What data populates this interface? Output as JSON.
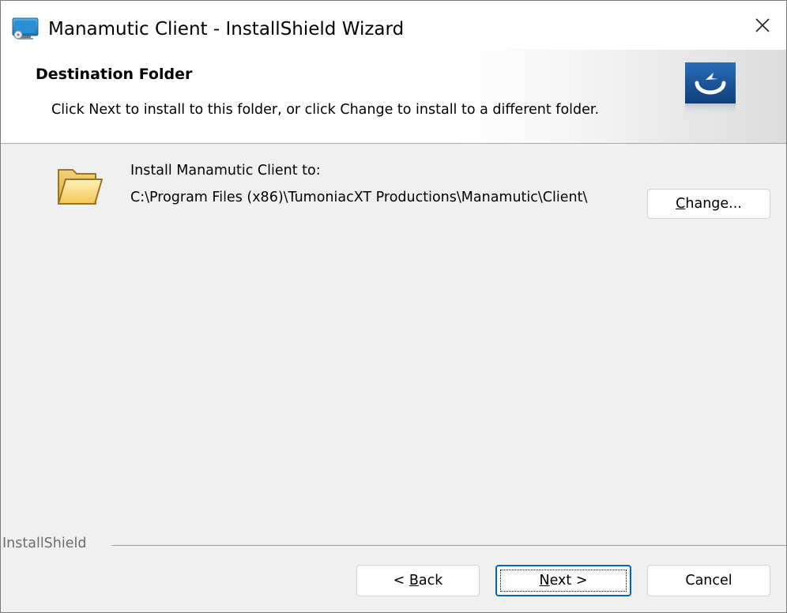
{
  "window": {
    "title": "Manamutic Client - InstallShield Wizard",
    "close_icon": "close-icon",
    "app_icon": "installer-app-icon"
  },
  "banner": {
    "title": "Destination Folder",
    "subtitle": "Click Next to install to this folder, or click Change to install to a different folder.",
    "logo_icon": "installshield-logo-icon"
  },
  "destination": {
    "label": "Install Manamutic Client to:",
    "path": "C:\\Program Files (x86)\\TumoniacXT Productions\\Manamutic\\Client\\",
    "folder_icon": "folder-icon",
    "change_button": {
      "mnemonic": "C",
      "rest": "hange..."
    }
  },
  "footer": {
    "brand_label": "InstallShield",
    "back_button": {
      "prefix": "< ",
      "mnemonic": "B",
      "rest": "ack"
    },
    "next_button": {
      "mnemonic": "N",
      "rest": "ext >"
    },
    "cancel_button": "Cancel"
  },
  "colors": {
    "dialog_background": "#f0f0f0",
    "title_background": "#ffffff",
    "accent_focus": "#0067c0",
    "footer_text": "#6d6d6d"
  }
}
